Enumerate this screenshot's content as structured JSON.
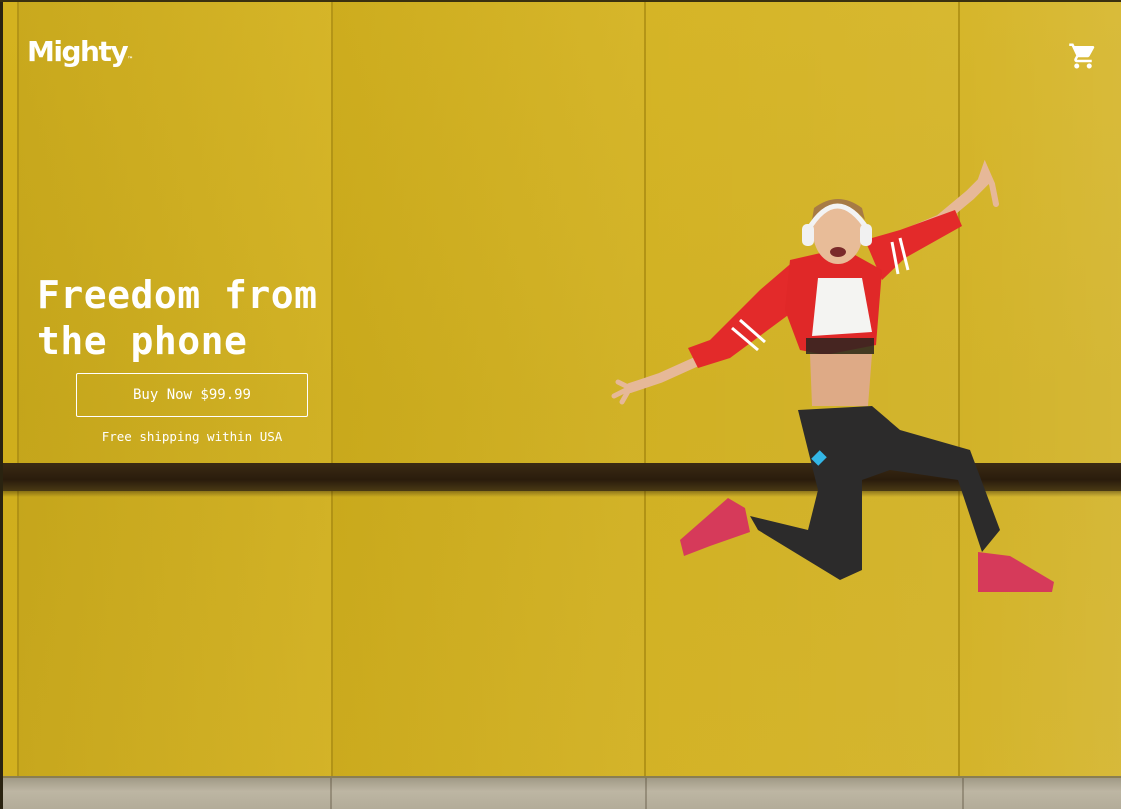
{
  "header": {
    "logo_text": "Mighty",
    "logo_tm": "™",
    "cart_icon": "shopping-cart-icon"
  },
  "hero": {
    "headline_line1": "Freedom from",
    "headline_line2": "the phone",
    "cta_label": "Buy Now $99.99",
    "shipping_note": "Free shipping within USA",
    "image_subject": "woman-jumping-with-headphones"
  },
  "colors": {
    "wall_yellow": "#d2b01f",
    "text_white": "#ffffff",
    "jacket_red": "#e02a2a",
    "rail_brown": "#2f2010"
  }
}
